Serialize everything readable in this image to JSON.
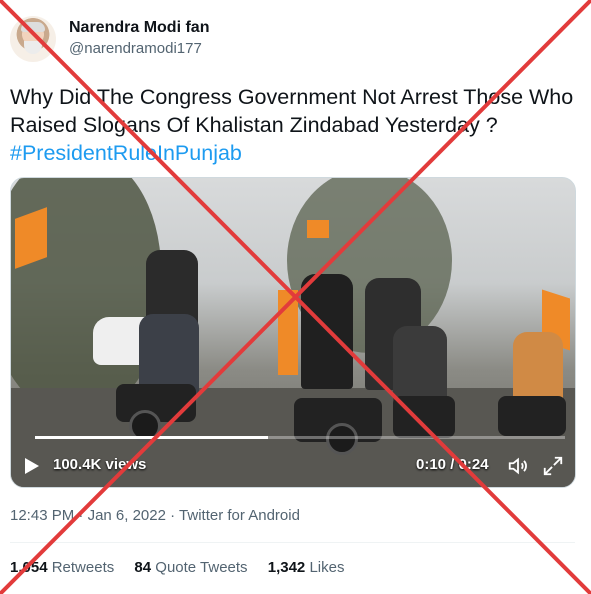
{
  "author": {
    "name": "Narendra Modi fan",
    "handle": "@narendramodi177"
  },
  "tweet": {
    "text": "Why Did The Congress Government Not Arrest Those Who Raised Slogans Of Khalistan Zindabad Yesterday ?",
    "hashtag": "#PresidentRuleInPunjab"
  },
  "video": {
    "views": "100.4K views",
    "time": "0:10 / 0:24",
    "progress": 0.44
  },
  "meta": {
    "time": "12:43 PM",
    "separator": "·",
    "date": "Jan 6, 2022",
    "source": "Twitter for Android"
  },
  "stats": {
    "retweets_count": "1,054",
    "retweets_label": "Retweets",
    "quotes_count": "84",
    "quotes_label": "Quote Tweets",
    "likes_count": "1,342",
    "likes_label": "Likes"
  },
  "colors": {
    "accent": "#1d9bf0",
    "cross": "#e23b3b",
    "flag": "#ef8a28"
  },
  "icons": [
    "play-icon",
    "volume-icon",
    "expand-icon"
  ]
}
